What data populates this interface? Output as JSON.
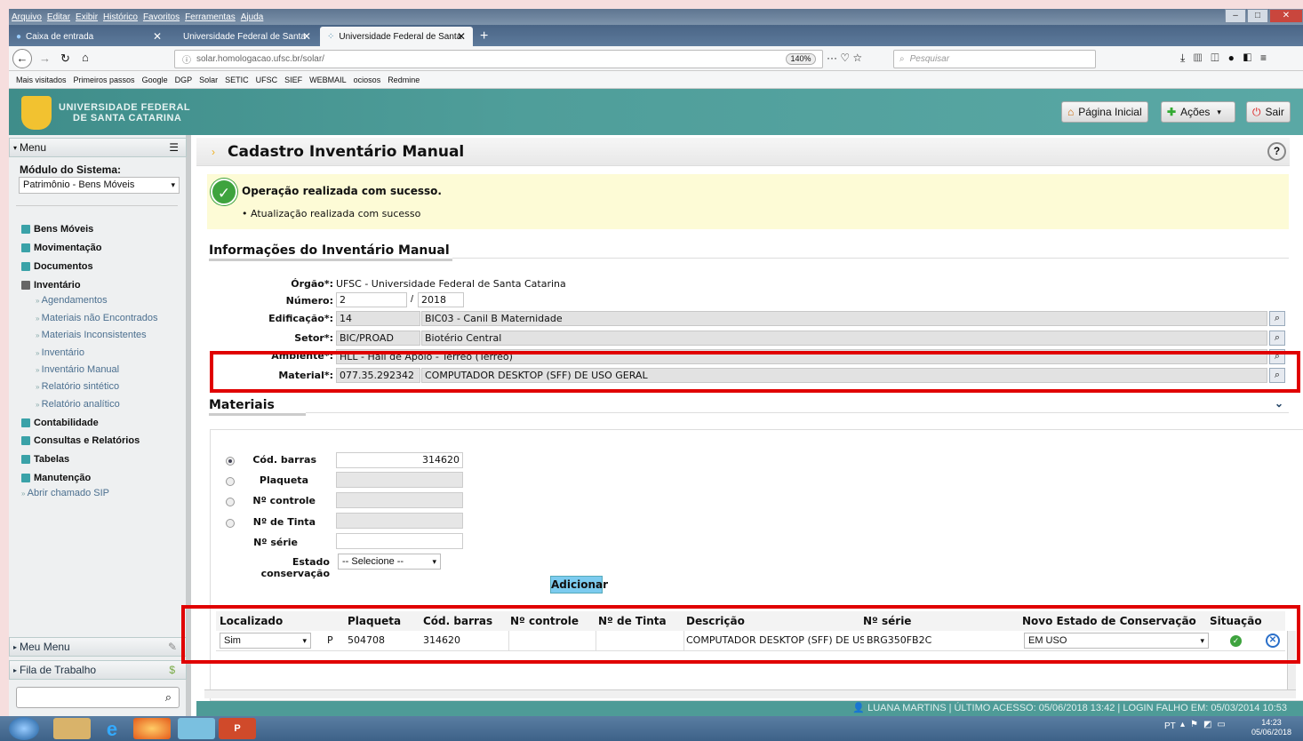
{
  "browser": {
    "menu": [
      "Arquivo",
      "Editar",
      "Exibir",
      "Histórico",
      "Favoritos",
      "Ferramentas",
      "Ajuda"
    ],
    "tabs": [
      {
        "label": "Caixa de entrada"
      },
      {
        "label": "Universidade Federal de Santa"
      },
      {
        "label": "Universidade Federal de Santa"
      }
    ],
    "url": "solar.homologacao.ufsc.br/solar/",
    "zoom": "140%",
    "search_placeholder": "Pesquisar",
    "bookmarks": [
      "Mais visitados",
      "Primeiros passos",
      "Google",
      "DGP",
      "Solar",
      "SETIC",
      "UFSC",
      "SIEF",
      "WEBMAIL",
      "ociosos",
      "Redmine"
    ]
  },
  "header": {
    "logo_line1": "UNIVERSIDADE FEDERAL",
    "logo_line2": "DE SANTA CATARINA",
    "home": "Página Inicial",
    "actions": "Ações",
    "exit": "Sair"
  },
  "sidebar": {
    "menu_label": "Menu",
    "module_label": "Módulo do Sistema:",
    "module_value": "Patrimônio - Bens Móveis",
    "items": [
      "Bens Móveis",
      "Movimentação",
      "Documentos",
      "Inventário",
      "Contabilidade",
      "Consultas e Relatórios",
      "Tabelas",
      "Manutenção"
    ],
    "inventario_sub": [
      "Agendamentos",
      "Materiais não Encontrados",
      "Materiais Inconsistentes",
      "Inventário",
      "Inventário Manual",
      "Relatório sintético",
      "Relatório analítico"
    ],
    "extra": "Abrir chamado SIP",
    "my_menu": "Meu Menu",
    "queue": "Fila de Trabalho"
  },
  "page": {
    "title": "Cadastro Inventário Manual",
    "help": "?"
  },
  "message": {
    "title": "Operação realizada com sucesso.",
    "detail": "Atualização realizada com sucesso"
  },
  "info": {
    "section": "Informações do Inventário Manual",
    "orgao_label": "Órgão*:",
    "orgao": "UFSC - Universidade Federal de Santa Catarina",
    "numero_label": "Número:",
    "numero": "2",
    "ano": "2018",
    "sep": "/",
    "edificacao_label": "Edificação*:",
    "edif_code": "14",
    "edif_name": "BIC03 - Canil B Maternidade",
    "setor_label": "Setor*:",
    "setor_code": "BIC/PROAD",
    "setor_name": "Biotério Central",
    "ambiente_label": "Ambiente*:",
    "ambiente": "HLL - Hall de Apoio - Térreo (Térreo)",
    "material_label": "Material*:",
    "mat_code": "077.35.292342",
    "mat_name": "COMPUTADOR DESKTOP (SFF) DE USO GERAL"
  },
  "materiais": {
    "section": "Materiais",
    "labels": [
      "Cód. barras",
      "Plaqueta",
      "Nº controle",
      "Nº de Tinta",
      "Nº série"
    ],
    "cod_barras": "314620",
    "estado_label": "Estado conservação",
    "estado_value": "-- Selecione --",
    "add_button": "Adicionar"
  },
  "table": {
    "headers": [
      "Localizado",
      "Plaqueta",
      "Cód. barras",
      "Nº controle",
      "Nº de Tinta",
      "Descrição",
      "Nº série",
      "Novo Estado de Conservação",
      "Situação"
    ],
    "rows": [
      {
        "localizado": "Sim",
        "tipo": "P",
        "plaqueta": "504708",
        "cod_barras": "314620",
        "controle": "",
        "tinta": "",
        "descricao": "COMPUTADOR DESKTOP (SFF) DE USO GERAL",
        "serie": "BRG350FB2C",
        "estado": "EM USO"
      }
    ]
  },
  "status": {
    "user": "LUANA MARTINS",
    "last": "ÚLTIMO ACESSO: 05/06/2018 13:42",
    "fail": "LOGIN FALHO EM: 05/03/2014 10:53"
  },
  "taskbar": {
    "lang": "PT",
    "time": "14:23",
    "date": "05/06/2018"
  }
}
